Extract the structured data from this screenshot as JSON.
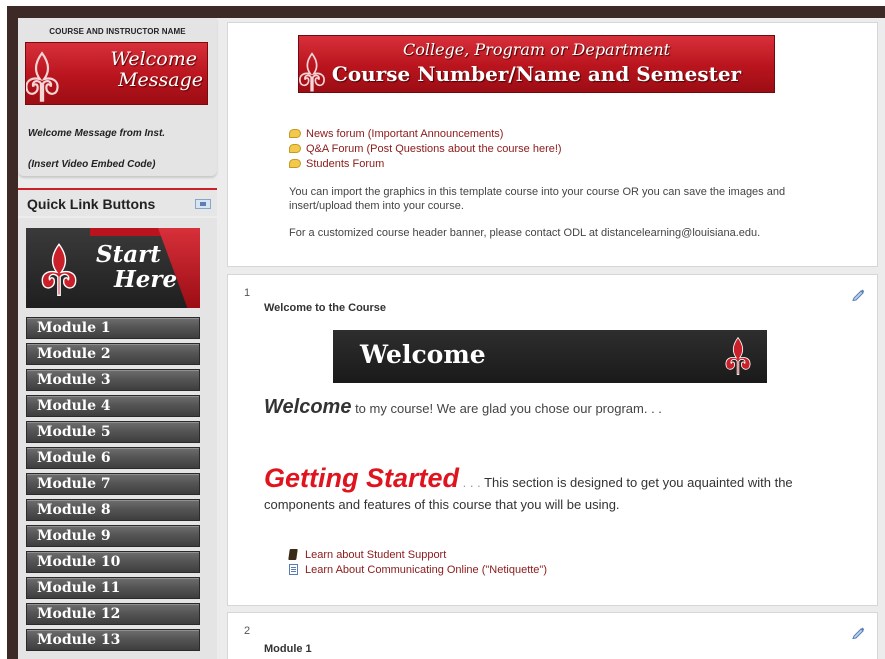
{
  "left_block": {
    "course_instructor": "COURSE AND INSTRUCTOR NAME",
    "welcome_banner_line1": "Welcome",
    "welcome_banner_line2": "Message",
    "welcome_message_from": "Welcome Message from Inst.",
    "video_embed": "(Insert Video Embed Code)"
  },
  "quick_links": {
    "title": "Quick Link Buttons",
    "start_here_line1": "Start",
    "start_here_line2": "Here",
    "modules": [
      "Module 1",
      "Module 2",
      "Module 3",
      "Module 4",
      "Module 5",
      "Module 6",
      "Module 7",
      "Module 8",
      "Module 9",
      "Module 10",
      "Module 11",
      "Module 12",
      "Module 13"
    ]
  },
  "header_banner": {
    "line1": "College, Program or Department",
    "line2": "Course Number/Name and Semester"
  },
  "forums": [
    "News forum (Important Announcements)",
    "Q&A Forum (Post Questions about the course here!)",
    "Students Forum"
  ],
  "import_text": "You can import the graphics in this template course into your course OR you can save the images and insert/upload them into your course.",
  "odl_text": "For a customized course header banner, please contact ODL at distancelearning@louisiana.edu.",
  "section1": {
    "number": "1",
    "title": "Welcome to the Course",
    "banner_text": "Welcome",
    "welcome_big": "Welcome",
    "welcome_rest": " to my course! We are glad you chose our program. . .",
    "getting_started": "Getting Started",
    "gs_dots": " . . . ",
    "gs_rest": "This section is designed to get you aquainted with the components and features of this course that you will be using.",
    "resources": [
      "Learn about Student Support",
      "Learn About Communicating Online (\"Netiquette\")"
    ]
  },
  "section2": {
    "number": "2",
    "title": "Module 1"
  },
  "colors": {
    "brand_red": "#b9141d",
    "link": "#8b1a1a",
    "accent_red_text": "#e0141e"
  },
  "icons": {
    "forum": "speech-bubble-icon",
    "edit": "pencil-edit-icon",
    "book": "book-icon",
    "page": "page-icon",
    "fleur": "fleur-de-lis-icon"
  }
}
